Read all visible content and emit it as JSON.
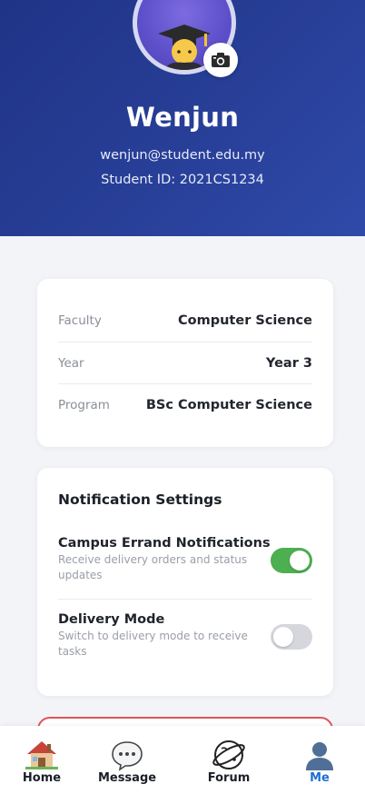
{
  "profile": {
    "name": "Wenjun",
    "email": "wenjun@student.edu.my",
    "student_id": "Student ID: 2021CS1234",
    "avatar_icon": "graduate-emoji-icon",
    "camera_icon": "camera-icon"
  },
  "info": {
    "rows": [
      {
        "label": "Faculty",
        "value": "Computer Science"
      },
      {
        "label": "Year",
        "value": "Year 3"
      },
      {
        "label": "Program",
        "value": "BSc Computer Science"
      }
    ]
  },
  "notifications": {
    "title": "Notification Settings",
    "settings": [
      {
        "title": "Campus Errand Notifications",
        "desc": "Receive delivery orders and status updates",
        "enabled": true
      },
      {
        "title": "Delivery Mode",
        "desc": "Switch to delivery mode to receive tasks",
        "enabled": false
      }
    ]
  },
  "tabs": [
    {
      "label": "Home",
      "icon": "house-icon",
      "active": false
    },
    {
      "label": "Message",
      "icon": "chat-bubble-icon",
      "active": false
    },
    {
      "label": "Forum",
      "icon": "planet-icon",
      "active": false
    },
    {
      "label": "Me",
      "icon": "person-icon",
      "active": true
    }
  ],
  "colors": {
    "header": "#283f98",
    "toggle_on": "#4caf50",
    "toggle_off": "#d5d7dc",
    "active_tab": "#1f6ed4",
    "logout_border": "#e0555b"
  }
}
